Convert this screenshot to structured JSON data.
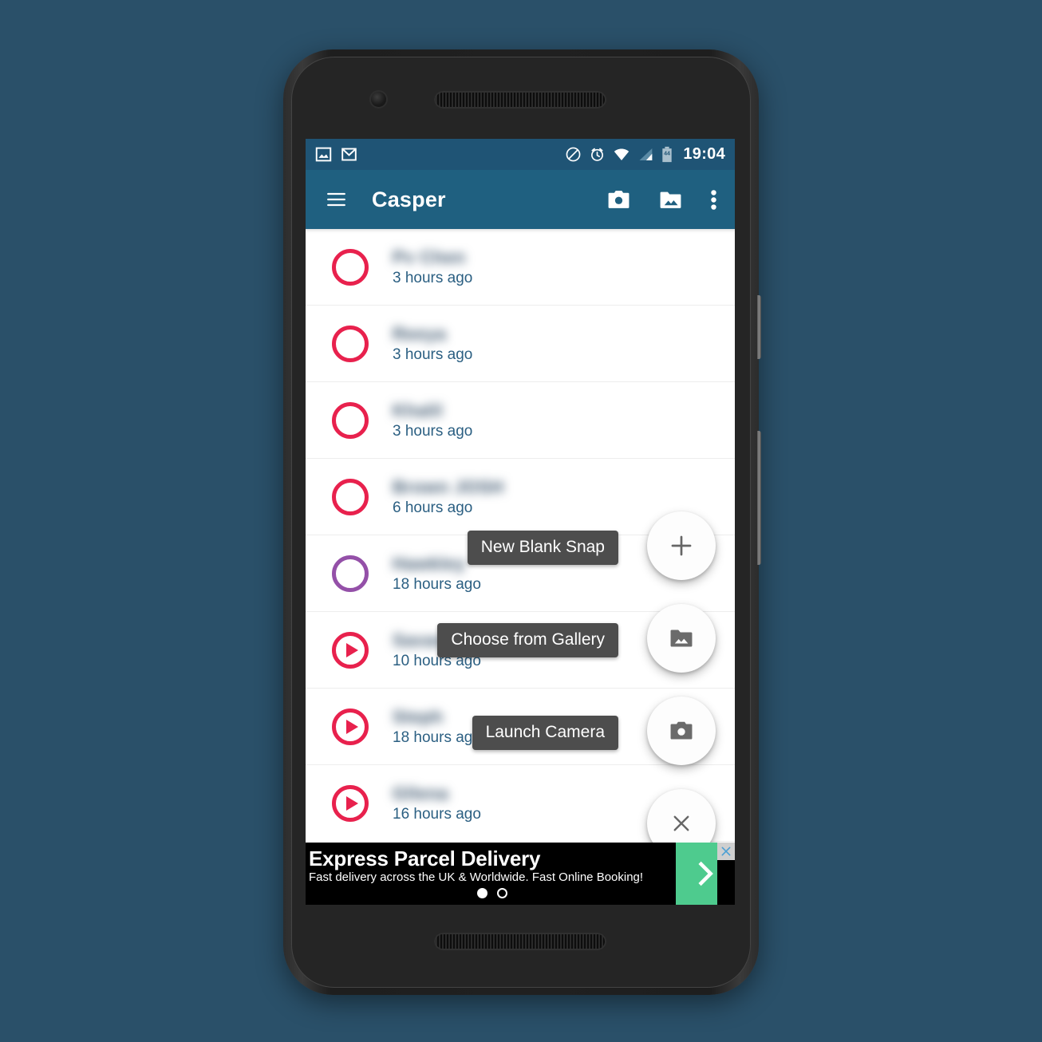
{
  "status_bar": {
    "time": "19:04",
    "battery_level": "44",
    "notification_icons": [
      "image-icon",
      "gmail-icon"
    ],
    "system_icons": [
      "do-not-disturb-icon",
      "alarm-icon",
      "wifi-icon",
      "cellular-signal-icon",
      "battery-icon"
    ],
    "background_color": "#1f5475"
  },
  "app_bar": {
    "title": "Casper",
    "menu_icon": "hamburger-menu-icon",
    "actions": [
      "camera-icon",
      "gallery-folder-icon",
      "overflow-menu-icon"
    ],
    "background_color": "#1f6080"
  },
  "snap_list": {
    "rows": [
      {
        "name": "Pv Chen",
        "time": "3 hours ago",
        "icon": "circle-ring-icon",
        "icon_color": "#e8214d"
      },
      {
        "name": "Reeya",
        "time": "3 hours ago",
        "icon": "circle-ring-icon",
        "icon_color": "#e8214d"
      },
      {
        "name": "Khalil",
        "time": "3 hours ago",
        "icon": "circle-ring-icon",
        "icon_color": "#e8214d"
      },
      {
        "name": "Brown JOSH",
        "time": "6 hours ago",
        "icon": "circle-ring-icon",
        "icon_color": "#e8214d"
      },
      {
        "name": "Hawkley",
        "time": "18 hours ago",
        "icon": "circle-ring-icon",
        "icon_color": "#9450a8"
      },
      {
        "name": "Savan",
        "time": "10 hours ago",
        "icon": "play-circle-icon",
        "icon_color": "#e8214d"
      },
      {
        "name": "Steph",
        "time": "18 hours ago",
        "icon": "play-circle-icon",
        "icon_color": "#e8214d"
      },
      {
        "name": "Gllena",
        "time": "16 hours ago",
        "icon": "play-circle-icon",
        "icon_color": "#e8214d"
      }
    ]
  },
  "fab_menu": {
    "items": [
      {
        "label": "New Blank Snap",
        "icon": "plus-icon"
      },
      {
        "label": "Choose from Gallery",
        "icon": "gallery-folder-icon"
      },
      {
        "label": "Launch Camera",
        "icon": "camera-icon"
      }
    ],
    "close_icon": "close-icon",
    "label_background": "#4d4d4d"
  },
  "ad_banner": {
    "headline": "Express Parcel Delivery",
    "subtext": "Fast delivery across the UK & Worldwide. Fast Online Booking!",
    "cta_icon": "chevron-right-icon",
    "close_icon": "close-icon",
    "cta_color": "#4ecb8e",
    "carousel": {
      "total": 2,
      "active": 1
    }
  },
  "page_background_color": "#2a5069"
}
